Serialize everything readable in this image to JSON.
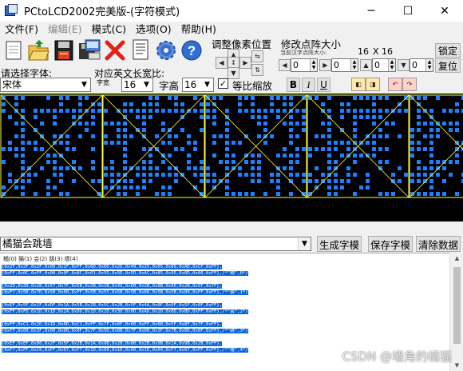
{
  "window": {
    "title": "PCtoLCD2002完美版-(字符模式)",
    "minimize": "─",
    "maximize": "☐",
    "close": "✕"
  },
  "menu": [
    {
      "label": "文件(F)",
      "disabled": false
    },
    {
      "label": "编辑(E)",
      "disabled": true
    },
    {
      "label": "模式(C)",
      "disabled": false
    },
    {
      "label": "选项(O)",
      "disabled": false
    },
    {
      "label": "帮助(H)",
      "disabled": false
    }
  ],
  "toolbar_icons": [
    "new-file-icon",
    "open-folder-icon",
    "save-disk-icon",
    "save-as-icon",
    "delete-x-icon",
    "document-icon",
    "settings-gear-icon",
    "help-icon"
  ],
  "pixel_adjust": {
    "label": "调整像素位置"
  },
  "dot_size": {
    "label": "修改点阵大小",
    "sub_label": "当前汉字点阵大小:",
    "width": "16",
    "x": "X",
    "height": "16",
    "spin1": "0",
    "spin2": "0",
    "spin3": "0",
    "spin4": "0",
    "lock_button": "锁定",
    "restore_button": "复位"
  },
  "font": {
    "select_label": "请选择字体:",
    "font_value": "宋体",
    "ratio_label": "对应英文长宽比:",
    "width_label": "字宽",
    "width_value": "16",
    "height_label": "字高",
    "height_value": "16",
    "proportional_label": "等比缩放",
    "proportional_checked": true,
    "bold": "B",
    "italic": "I",
    "underline": "U"
  },
  "led": {
    "bg_color": "#000000",
    "dot_color": "#1e7fff",
    "grid_color": "#ffff33"
  },
  "input_text": "橘猫会跳墙",
  "buttons": {
    "generate": "生成字模",
    "save": "保存字模",
    "clear": "清除数据"
  },
  "output_header": "橘(0) 猫(1) 会(2) 跳(3) 墙(4)",
  "output_lines": [
    "{0x2F,0x2F,0x2F,0x00,0x2F,0xFF,0x6D,0x6D,0x2D,0x49,0x25,0x05,0x89,0xAD,0xCF,0xFF},",
    "{0xFF,0x0C,0xFF,0x00,0x0F,0x8C,0x01,0x5D,0x5D,0x5D,0xAC,0x85,0x95,0x0D,0x00,0xFF},/*\"橘\",0*/",
    "",
    "{0x2D,0x2D,0x2B,0x57,0x7F,0x5B,0x2B,0x2B,0x49,0xEB,0x2B,0x8B,0xA0,0x2B,0x5F,0x7F},",
    "{0xF7,0x5B,0x7D,0x5B,0x00,0xFF,0x5B,0x55,0x5B,0x5B,0x80,0x5B,0x5B,0x00,0xFF,0xFF},/*\"猫\",1*/",
    "",
    "{0xEF,0x5F,0x2F,0xDF,0x1A,0x5B,0x2B,0x5C,0x2B,0x5F,0x4A,0x0F,0x0F,0x5F,0x0F,0xFF},",
    "{0xFF,0xFD,0x1D,0x1D,0x2A,0x0D,0x1D,0x2D,0x3D,0x0D,0xAD,0x2D,0x0D,0x0D,0xFF,0xFF},/*\"会\",2*/",
    "",
    "{0xFF,0xC1,0x2D,0x1D,0x0D,0xC1,0xFF,0x7F,0x0F,0x00,0xFF,0x00,0x5F,0x8F,0x7F,0xFF},",
    "{0xFF,0x00,0x3F,0x00,0x00,0x0F,0x7F,0x5D,0x0B,0x7F,0x00,0x3F,0x7B,0x0D,0x0F,0xFF},/*\"跳\",3*/",
    "",
    "{0xEF,0xEF,0x00,0x2F,0x5F,0x2B,0x1A,0x9B,0x2B,0x80,0x2B,0x9B,0x1A,0x9B,0x2B,0xFF},",
    "{0xF7,0xFF,0xC0,0xFF,0x07,0xF7,0x1D,0x00,0x1D,0x00,0x1D,0xA4,0xF7,0x07,0xFF,0xFF},/*\"墙\",4*/"
  ],
  "watermark": "CSDN @墙角的橘猫"
}
